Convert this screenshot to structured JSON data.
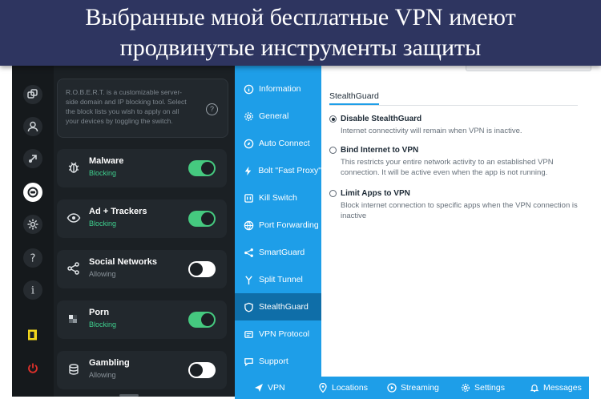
{
  "banner": {
    "line1": "Выбранные мной бесплатные VPN имеют",
    "line2": "продвинутые инструменты защиты"
  },
  "left_panel": {
    "info_text": "R.O.B.E.R.T. is a customizable server-side domain and IP blocking tool. Select the block lists you wish to apply on all your devices by toggling the switch.",
    "info_icon": "question-icon",
    "rail_icons": [
      "link-icon",
      "user-icon",
      "rocket-icon",
      "robert-icon",
      "gear-icon",
      "help-icon",
      "info-icon",
      "exit-icon",
      "power-icon"
    ],
    "items": [
      {
        "title": "Malware",
        "status": "Blocking",
        "on": true,
        "icon": "bug-icon"
      },
      {
        "title": "Ad + Trackers",
        "status": "Blocking",
        "on": true,
        "icon": "eye-icon"
      },
      {
        "title": "Social Networks",
        "status": "Allowing",
        "on": false,
        "icon": "share-icon"
      },
      {
        "title": "Porn",
        "status": "Blocking",
        "on": true,
        "icon": "pixel-icon"
      },
      {
        "title": "Gambling",
        "status": "Allowing",
        "on": false,
        "icon": "coins-icon"
      }
    ]
  },
  "right_panel": {
    "nav": [
      {
        "label": "Information",
        "icon": "info-icon"
      },
      {
        "label": "General",
        "icon": "gear-icon"
      },
      {
        "label": "Auto Connect",
        "icon": "compass-icon"
      },
      {
        "label": "Bolt \"Fast Proxy\"",
        "icon": "bolt-icon"
      },
      {
        "label": "Kill Switch",
        "icon": "switch-icon"
      },
      {
        "label": "Port Forwarding",
        "icon": "globe-icon"
      },
      {
        "label": "SmartGuard",
        "icon": "nodes-icon"
      },
      {
        "label": "Split Tunnel",
        "icon": "split-icon"
      },
      {
        "label": "StealthGuard",
        "icon": "shield-icon"
      },
      {
        "label": "VPN Protocol",
        "icon": "protocol-icon"
      },
      {
        "label": "Support",
        "icon": "chat-icon"
      }
    ],
    "active_nav": "StealthGuard",
    "tab": "StealthGuard",
    "options": [
      {
        "title": "Disable StealthGuard",
        "desc": "Internet connectivity will remain when VPN is inactive.",
        "selected": true
      },
      {
        "title": "Bind Internet to VPN",
        "desc": "This restricts your entire network activity to an established VPN connection. It will be active even when the app is not running.",
        "selected": false
      },
      {
        "title": "Limit Apps to VPN",
        "desc": "Block internet connection to specific apps when the VPN connection is inactive",
        "selected": false
      }
    ],
    "bottom_tabs": [
      {
        "label": "VPN",
        "icon": "vpn-arrow-icon"
      },
      {
        "label": "Locations",
        "icon": "location-pin-icon"
      },
      {
        "label": "Streaming",
        "icon": "play-icon"
      },
      {
        "label": "Settings",
        "icon": "gear-icon"
      },
      {
        "label": "Messages",
        "icon": "bell-icon"
      }
    ]
  },
  "colors": {
    "banner_bg": "#2e3560",
    "dark_bg": "#1b2024",
    "toggle_on": "#45c97f",
    "blocking_green": "#3fcf8e",
    "nav_blue": "#1e9ee8",
    "nav_active": "#0f6ea8"
  }
}
